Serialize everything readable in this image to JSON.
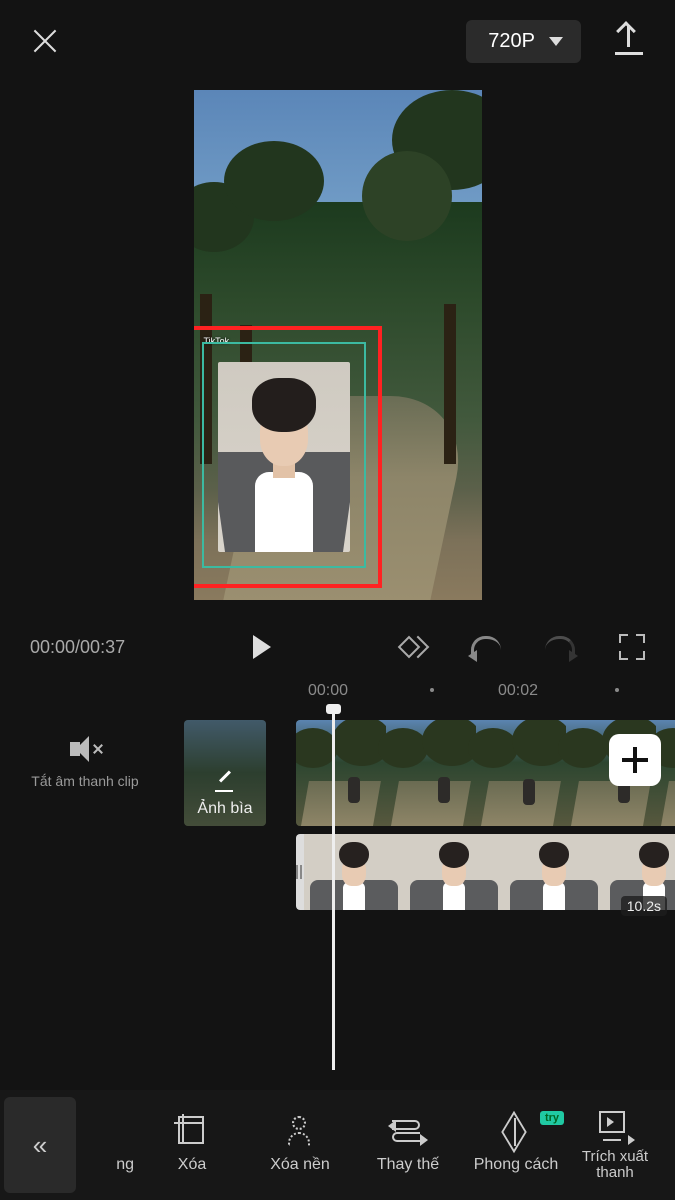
{
  "top": {
    "resolution": "720P"
  },
  "preview": {
    "watermark": "TikTok"
  },
  "controls": {
    "timecode": "00:00/00:37"
  },
  "ruler": {
    "t0": "00:00",
    "t1": "00:02"
  },
  "timeline": {
    "mute_label": "Tắt âm thanh clip",
    "cover_label": "Ảnh bìa",
    "pip_duration": "10.2s"
  },
  "tools": {
    "partial_left": "ng",
    "crop": "Xóa",
    "remove_bg": "Xóa nền",
    "replace": "Thay thế",
    "style": "Phong cách",
    "style_badge": "try",
    "extract": "Trích xuất thanh"
  }
}
